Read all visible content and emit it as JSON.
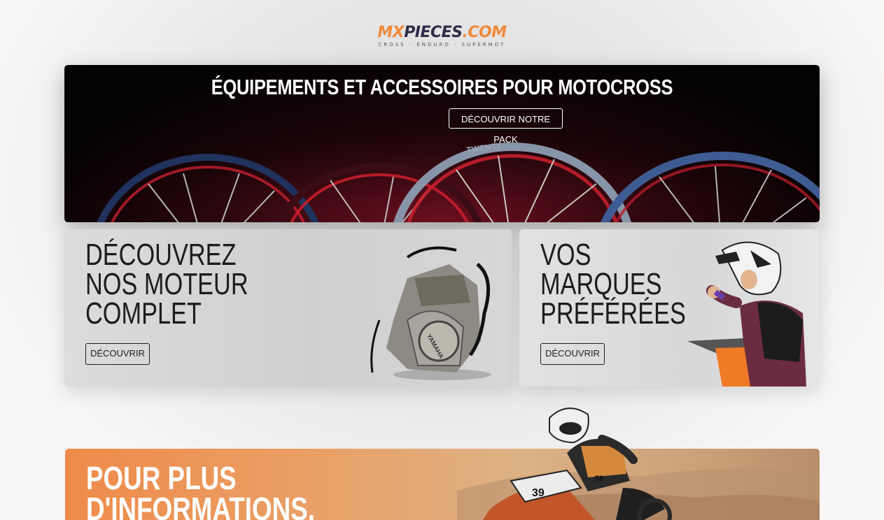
{
  "logo": {
    "mx": "MX",
    "pieces": "PIECES",
    "com": ".COM",
    "tagline": "CROSS · ENDURO · SUPERMOT"
  },
  "hero": {
    "title": "ÉQUIPEMENTS ET ACCESSOIRES POUR MOTOCROSS",
    "button_label": "DÉCOUVRIR NOTRE PACK",
    "rim_brand": "TWENTY"
  },
  "cards": {
    "engine": {
      "title_lines": [
        "DÉCOUVREZ",
        "NOS MOTEUR",
        "COMPLET"
      ],
      "button_label": "DÉCOUVRIR",
      "engine_brand": "YAMAHA"
    },
    "brands": {
      "title_lines": [
        "VOS",
        "MARQUES",
        "PRÉFÉRÉES"
      ],
      "button_label": "DÉCOUVRIR"
    }
  },
  "info": {
    "title_lines": [
      "POUR PLUS",
      "D'INFORMATIONS,"
    ],
    "rider_plate": "39",
    "rider_number": "59"
  },
  "colors": {
    "brand_orange": "#f08a3a",
    "brand_navy": "#2e2e4a",
    "hero_bg": "#050203",
    "card_text": "#1d1d1d"
  }
}
